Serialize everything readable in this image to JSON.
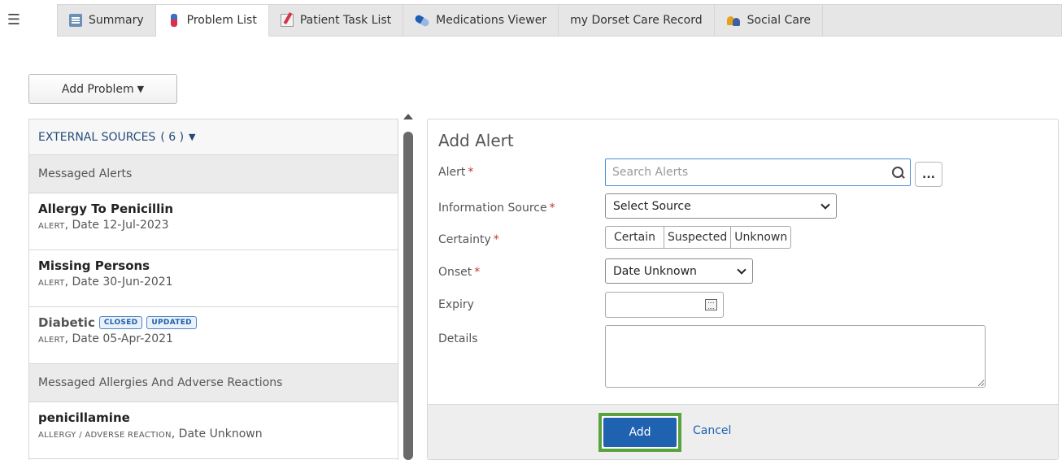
{
  "tabs": [
    {
      "label": "Summary",
      "icon": "summary-icon",
      "active": false
    },
    {
      "label": "Problem List",
      "icon": "thermometer-icon",
      "active": true
    },
    {
      "label": "Patient Task List",
      "icon": "task-icon",
      "active": false
    },
    {
      "label": "Medications Viewer",
      "icon": "pill-icon",
      "active": false
    },
    {
      "label": "my Dorset Care Record",
      "icon": "",
      "active": false
    },
    {
      "label": "Social Care",
      "icon": "people-icon",
      "active": false
    }
  ],
  "toolbar": {
    "add_problem_label": "Add Problem"
  },
  "left_panel": {
    "external_sources_label": "EXTERNAL SOURCES",
    "external_sources_count": "( 6 )",
    "sections": [
      {
        "title": "Messaged Alerts",
        "items": [
          {
            "title": "Allergy To Penicillin",
            "type": "ALERT",
            "date": ", Date 12-Jul-2023"
          },
          {
            "title": "Missing Persons",
            "type": "ALERT",
            "date": ", Date 30-Jun-2021"
          },
          {
            "title": "Diabetic",
            "type": "ALERT",
            "date": ", Date 05-Apr-2021",
            "badges": [
              "CLOSED",
              "UPDATED"
            ]
          }
        ]
      },
      {
        "title": "Messaged Allergies And Adverse Reactions",
        "items": [
          {
            "title": "penicillamine",
            "type": "ALLERGY / ADVERSE REACTION",
            "date": ", Date Unknown"
          }
        ]
      }
    ]
  },
  "form": {
    "title": "Add Alert",
    "alert_label": "Alert",
    "alert_placeholder": "Search Alerts",
    "ellipsis_label": "...",
    "source_label": "Information Source",
    "source_value": "Select Source",
    "certainty_label": "Certainty",
    "certainty_options": [
      "Certain",
      "Suspected",
      "Unknown"
    ],
    "onset_label": "Onset",
    "onset_value": "Date Unknown",
    "expiry_label": "Expiry",
    "details_label": "Details",
    "required_marker": "*",
    "add_label": "Add",
    "cancel_label": "Cancel"
  },
  "colors": {
    "accent": "#1f62b0",
    "highlight": "#5aa33c",
    "required": "#c0392b"
  }
}
